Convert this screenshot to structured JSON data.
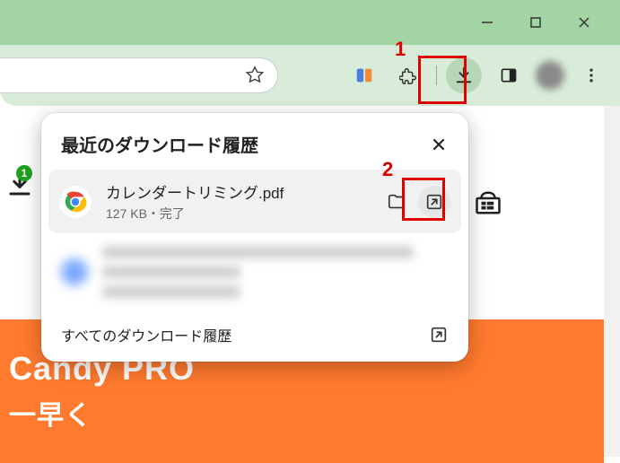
{
  "window": {
    "minimize": "—",
    "maximize": "❐",
    "close": "✕"
  },
  "toolbar": {
    "star": "bookmark",
    "downloads_badge": "1"
  },
  "callouts": {
    "c1": "1",
    "c2": "2"
  },
  "popup": {
    "title": "最近のダウンロード履歴",
    "items": [
      {
        "name": "カレンダートリミング.pdf",
        "meta": "127 KB・完了"
      }
    ],
    "footer": "すべてのダウンロード履歴"
  },
  "page": {
    "banner_line1": "Candy PRO",
    "banner_line2": "一早く"
  }
}
